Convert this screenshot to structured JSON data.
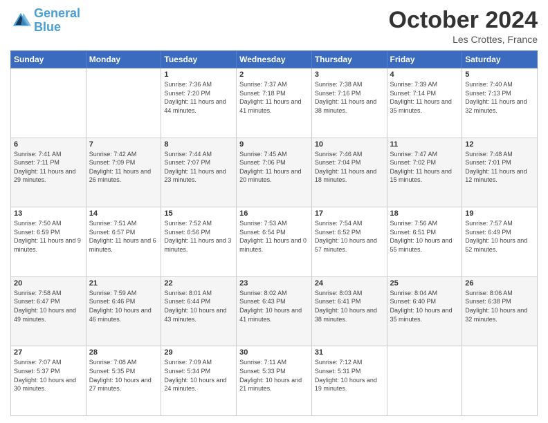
{
  "header": {
    "logo_line1": "General",
    "logo_line2": "Blue",
    "month": "October 2024",
    "location": "Les Crottes, France"
  },
  "weekdays": [
    "Sunday",
    "Monday",
    "Tuesday",
    "Wednesday",
    "Thursday",
    "Friday",
    "Saturday"
  ],
  "weeks": [
    [
      {
        "day": "",
        "sunrise": "",
        "sunset": "",
        "daylight": ""
      },
      {
        "day": "",
        "sunrise": "",
        "sunset": "",
        "daylight": ""
      },
      {
        "day": "1",
        "sunrise": "Sunrise: 7:36 AM",
        "sunset": "Sunset: 7:20 PM",
        "daylight": "Daylight: 11 hours and 44 minutes."
      },
      {
        "day": "2",
        "sunrise": "Sunrise: 7:37 AM",
        "sunset": "Sunset: 7:18 PM",
        "daylight": "Daylight: 11 hours and 41 minutes."
      },
      {
        "day": "3",
        "sunrise": "Sunrise: 7:38 AM",
        "sunset": "Sunset: 7:16 PM",
        "daylight": "Daylight: 11 hours and 38 minutes."
      },
      {
        "day": "4",
        "sunrise": "Sunrise: 7:39 AM",
        "sunset": "Sunset: 7:14 PM",
        "daylight": "Daylight: 11 hours and 35 minutes."
      },
      {
        "day": "5",
        "sunrise": "Sunrise: 7:40 AM",
        "sunset": "Sunset: 7:13 PM",
        "daylight": "Daylight: 11 hours and 32 minutes."
      }
    ],
    [
      {
        "day": "6",
        "sunrise": "Sunrise: 7:41 AM",
        "sunset": "Sunset: 7:11 PM",
        "daylight": "Daylight: 11 hours and 29 minutes."
      },
      {
        "day": "7",
        "sunrise": "Sunrise: 7:42 AM",
        "sunset": "Sunset: 7:09 PM",
        "daylight": "Daylight: 11 hours and 26 minutes."
      },
      {
        "day": "8",
        "sunrise": "Sunrise: 7:44 AM",
        "sunset": "Sunset: 7:07 PM",
        "daylight": "Daylight: 11 hours and 23 minutes."
      },
      {
        "day": "9",
        "sunrise": "Sunrise: 7:45 AM",
        "sunset": "Sunset: 7:06 PM",
        "daylight": "Daylight: 11 hours and 20 minutes."
      },
      {
        "day": "10",
        "sunrise": "Sunrise: 7:46 AM",
        "sunset": "Sunset: 7:04 PM",
        "daylight": "Daylight: 11 hours and 18 minutes."
      },
      {
        "day": "11",
        "sunrise": "Sunrise: 7:47 AM",
        "sunset": "Sunset: 7:02 PM",
        "daylight": "Daylight: 11 hours and 15 minutes."
      },
      {
        "day": "12",
        "sunrise": "Sunrise: 7:48 AM",
        "sunset": "Sunset: 7:01 PM",
        "daylight": "Daylight: 11 hours and 12 minutes."
      }
    ],
    [
      {
        "day": "13",
        "sunrise": "Sunrise: 7:50 AM",
        "sunset": "Sunset: 6:59 PM",
        "daylight": "Daylight: 11 hours and 9 minutes."
      },
      {
        "day": "14",
        "sunrise": "Sunrise: 7:51 AM",
        "sunset": "Sunset: 6:57 PM",
        "daylight": "Daylight: 11 hours and 6 minutes."
      },
      {
        "day": "15",
        "sunrise": "Sunrise: 7:52 AM",
        "sunset": "Sunset: 6:56 PM",
        "daylight": "Daylight: 11 hours and 3 minutes."
      },
      {
        "day": "16",
        "sunrise": "Sunrise: 7:53 AM",
        "sunset": "Sunset: 6:54 PM",
        "daylight": "Daylight: 11 hours and 0 minutes."
      },
      {
        "day": "17",
        "sunrise": "Sunrise: 7:54 AM",
        "sunset": "Sunset: 6:52 PM",
        "daylight": "Daylight: 10 hours and 57 minutes."
      },
      {
        "day": "18",
        "sunrise": "Sunrise: 7:56 AM",
        "sunset": "Sunset: 6:51 PM",
        "daylight": "Daylight: 10 hours and 55 minutes."
      },
      {
        "day": "19",
        "sunrise": "Sunrise: 7:57 AM",
        "sunset": "Sunset: 6:49 PM",
        "daylight": "Daylight: 10 hours and 52 minutes."
      }
    ],
    [
      {
        "day": "20",
        "sunrise": "Sunrise: 7:58 AM",
        "sunset": "Sunset: 6:47 PM",
        "daylight": "Daylight: 10 hours and 49 minutes."
      },
      {
        "day": "21",
        "sunrise": "Sunrise: 7:59 AM",
        "sunset": "Sunset: 6:46 PM",
        "daylight": "Daylight: 10 hours and 46 minutes."
      },
      {
        "day": "22",
        "sunrise": "Sunrise: 8:01 AM",
        "sunset": "Sunset: 6:44 PM",
        "daylight": "Daylight: 10 hours and 43 minutes."
      },
      {
        "day": "23",
        "sunrise": "Sunrise: 8:02 AM",
        "sunset": "Sunset: 6:43 PM",
        "daylight": "Daylight: 10 hours and 41 minutes."
      },
      {
        "day": "24",
        "sunrise": "Sunrise: 8:03 AM",
        "sunset": "Sunset: 6:41 PM",
        "daylight": "Daylight: 10 hours and 38 minutes."
      },
      {
        "day": "25",
        "sunrise": "Sunrise: 8:04 AM",
        "sunset": "Sunset: 6:40 PM",
        "daylight": "Daylight: 10 hours and 35 minutes."
      },
      {
        "day": "26",
        "sunrise": "Sunrise: 8:06 AM",
        "sunset": "Sunset: 6:38 PM",
        "daylight": "Daylight: 10 hours and 32 minutes."
      }
    ],
    [
      {
        "day": "27",
        "sunrise": "Sunrise: 7:07 AM",
        "sunset": "Sunset: 5:37 PM",
        "daylight": "Daylight: 10 hours and 30 minutes."
      },
      {
        "day": "28",
        "sunrise": "Sunrise: 7:08 AM",
        "sunset": "Sunset: 5:35 PM",
        "daylight": "Daylight: 10 hours and 27 minutes."
      },
      {
        "day": "29",
        "sunrise": "Sunrise: 7:09 AM",
        "sunset": "Sunset: 5:34 PM",
        "daylight": "Daylight: 10 hours and 24 minutes."
      },
      {
        "day": "30",
        "sunrise": "Sunrise: 7:11 AM",
        "sunset": "Sunset: 5:33 PM",
        "daylight": "Daylight: 10 hours and 21 minutes."
      },
      {
        "day": "31",
        "sunrise": "Sunrise: 7:12 AM",
        "sunset": "Sunset: 5:31 PM",
        "daylight": "Daylight: 10 hours and 19 minutes."
      },
      {
        "day": "",
        "sunrise": "",
        "sunset": "",
        "daylight": ""
      },
      {
        "day": "",
        "sunrise": "",
        "sunset": "",
        "daylight": ""
      }
    ]
  ]
}
